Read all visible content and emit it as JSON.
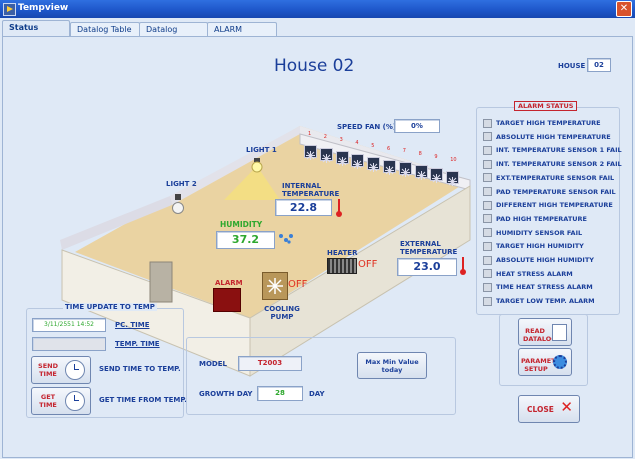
{
  "window": {
    "title": "Tempview"
  },
  "tabs": [
    {
      "label": "Status",
      "active": true
    },
    {
      "label": "Datalog Table",
      "active": false
    },
    {
      "label": "Datalog Graph",
      "active": false
    },
    {
      "label": "ALARM",
      "active": false
    }
  ],
  "house": {
    "heading": "House 02",
    "label": "HOUSE",
    "value": "02"
  },
  "sensors": {
    "speed_fan_label": "SPEED FAN (%)",
    "speed_fan_value": "0%",
    "light1": "LIGHT 1",
    "light2": "LIGHT 2",
    "internal_temp_label": "INTERNAL TEMPERATURE",
    "internal_temp_value": "22.8",
    "humidity_label": "HUMIDITY",
    "humidity_value": "37.2",
    "heater_label": "HEATER",
    "heater_state": "OFF",
    "external_temp_label": "EXTERNAL TEMPERATURE",
    "external_temp_value": "23.0",
    "alarm_label": "ALARM",
    "cooling_label": "COOLING PUMP",
    "cooling_state": "OFF",
    "fan_numbers": [
      "1",
      "2",
      "3",
      "4",
      "5",
      "6",
      "7",
      "8",
      "9",
      "10"
    ]
  },
  "alarm_status": {
    "title": "ALARM STATUS",
    "items": [
      "TARGET HIGH TEMPERATURE",
      "ABSOLUTE HIGH TEMPERATURE",
      "INT. TEMPERATURE SENSOR 1 FAIL",
      "INT. TEMPERATURE SENSOR 2 FAIL",
      "EXT.TEMPERATURE SENSOR  FAIL",
      "PAD TEMPERATURE SENSOR FAIL",
      "DIFFERENT HIGH TEMPERATURE",
      "PAD HIGH TEMPERATURE",
      "HUMIDITY SENSOR FAIL",
      "TARGET HIGH HUMIDITY",
      "ABSOLUTE HIGH  HUMIDITY",
      "HEAT STRESS  ALARM",
      "TIME HEAT STRESS  ALARM",
      "TARGET LOW TEMP.  ALARM"
    ]
  },
  "time_update": {
    "title": "TIME UPDATE TO TEMP",
    "pc_time_value": "3/11/2551  14:52",
    "pc_time_label": "PC. TIME",
    "temp_time_value": "",
    "temp_time_label": "TEMP. TIME",
    "send_button": "SEND TIME",
    "send_desc": "SEND TIME TO TEMP.",
    "get_button": "GET TIME",
    "get_desc": "GET TIME FROM TEMP."
  },
  "model": {
    "model_label": "MODEL",
    "model_value": "T2003",
    "maxmin_button": "Max Min Value today",
    "growth_label": "GROWTH DAY",
    "growth_value": "28",
    "growth_unit": "DAY"
  },
  "actions": {
    "read_datalog": "READ DATALOG",
    "parameter_setup": "PARAMETER SETUP",
    "close": "CLOSE"
  },
  "colors": {
    "accent": "#1b3f9a",
    "alarm": "#c4242e",
    "humidity": "#2ea82e",
    "off": "#e03020"
  }
}
